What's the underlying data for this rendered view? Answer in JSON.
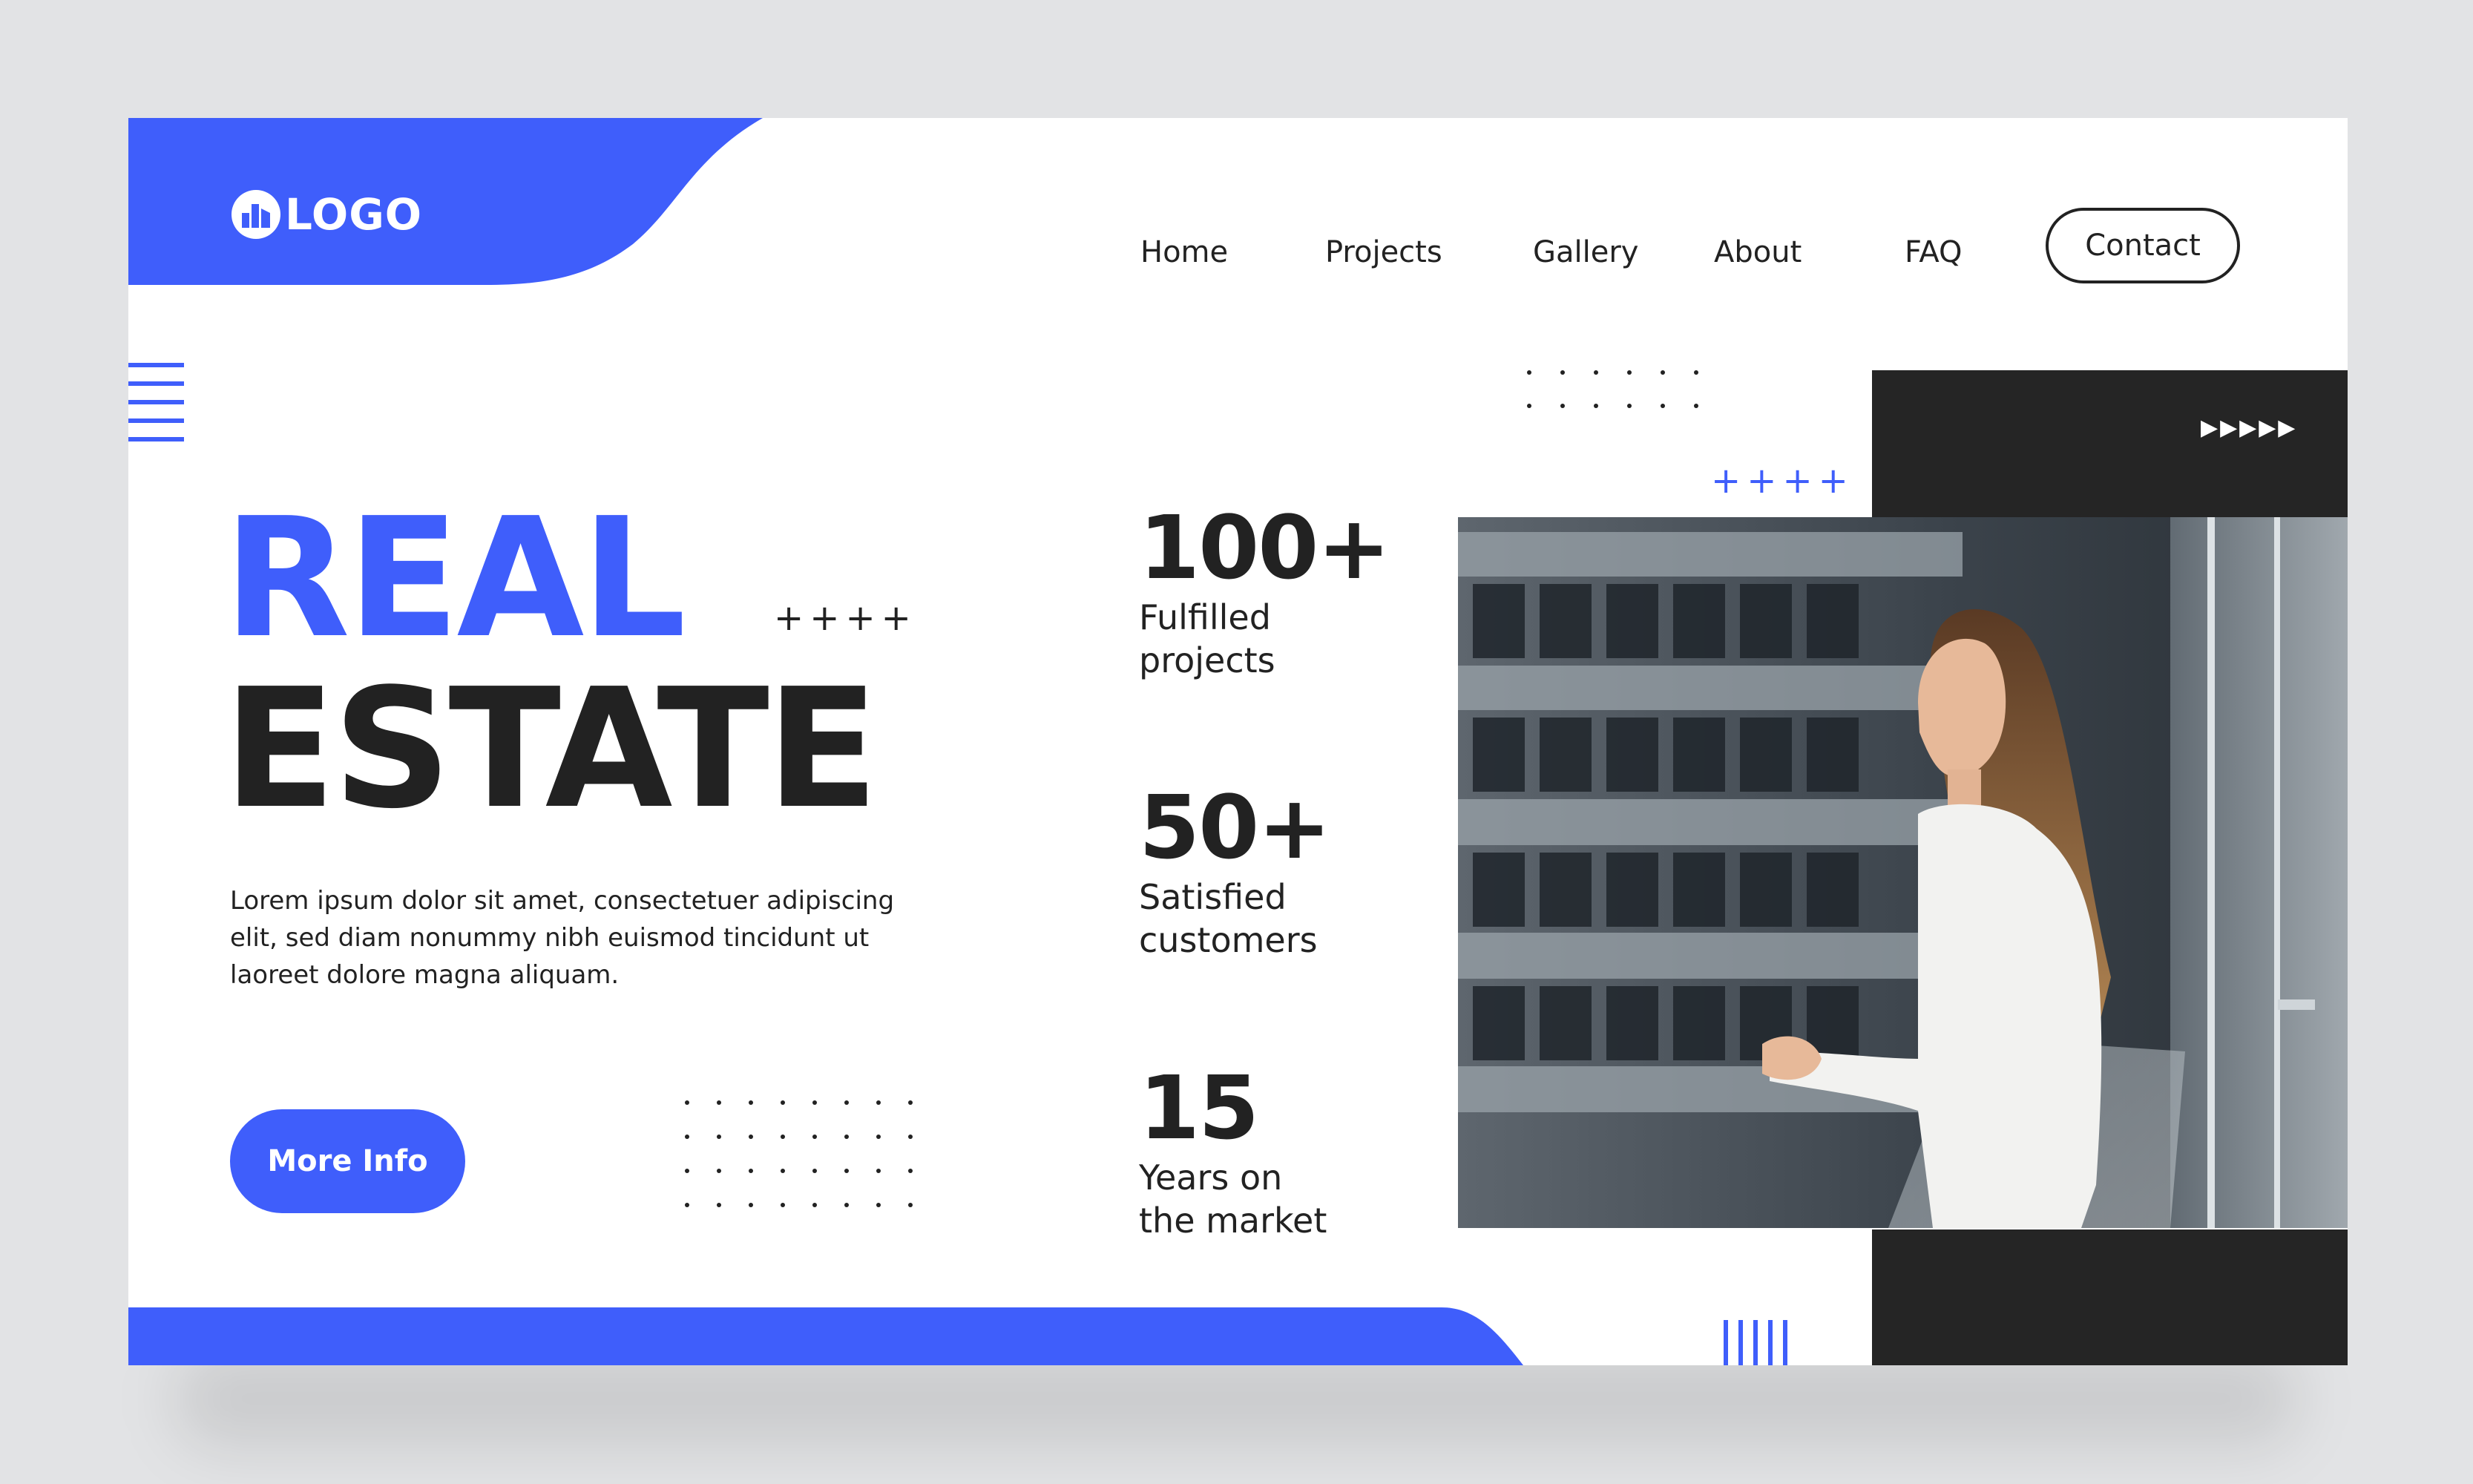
{
  "brand": {
    "logo_text": "LOGO",
    "colors": {
      "accent": "#3f5efb",
      "dark": "#252525",
      "text": "#222222",
      "background": "#e2e3e5"
    }
  },
  "nav": {
    "items": [
      {
        "label": "Home"
      },
      {
        "label": "Projects"
      },
      {
        "label": "Gallery"
      },
      {
        "label": "About"
      },
      {
        "label": "FAQ"
      }
    ],
    "contact_label": "Contact"
  },
  "hero": {
    "title_line1": "REAL",
    "title_line2": "ESTATE",
    "description": "Lorem ipsum dolor sit amet, consectetuer adipiscing elit, sed diam nonummy nibh euismod tincidunt ut laoreet dolore magna aliquam.",
    "cta_label": "More Info"
  },
  "stats": [
    {
      "value": "100+",
      "label_line1": "Fulfilled",
      "label_line2": "projects"
    },
    {
      "value": "50+",
      "label_line1": "Satisfied",
      "label_line2": "customers"
    },
    {
      "value": "15",
      "label_line1": "Years on",
      "label_line2": "the market"
    }
  ],
  "decor": {
    "plus_row": "++++",
    "arrows": "▶▶▶▶▶",
    "icons": [
      "building-logo-icon",
      "play-arrows-icon"
    ]
  }
}
